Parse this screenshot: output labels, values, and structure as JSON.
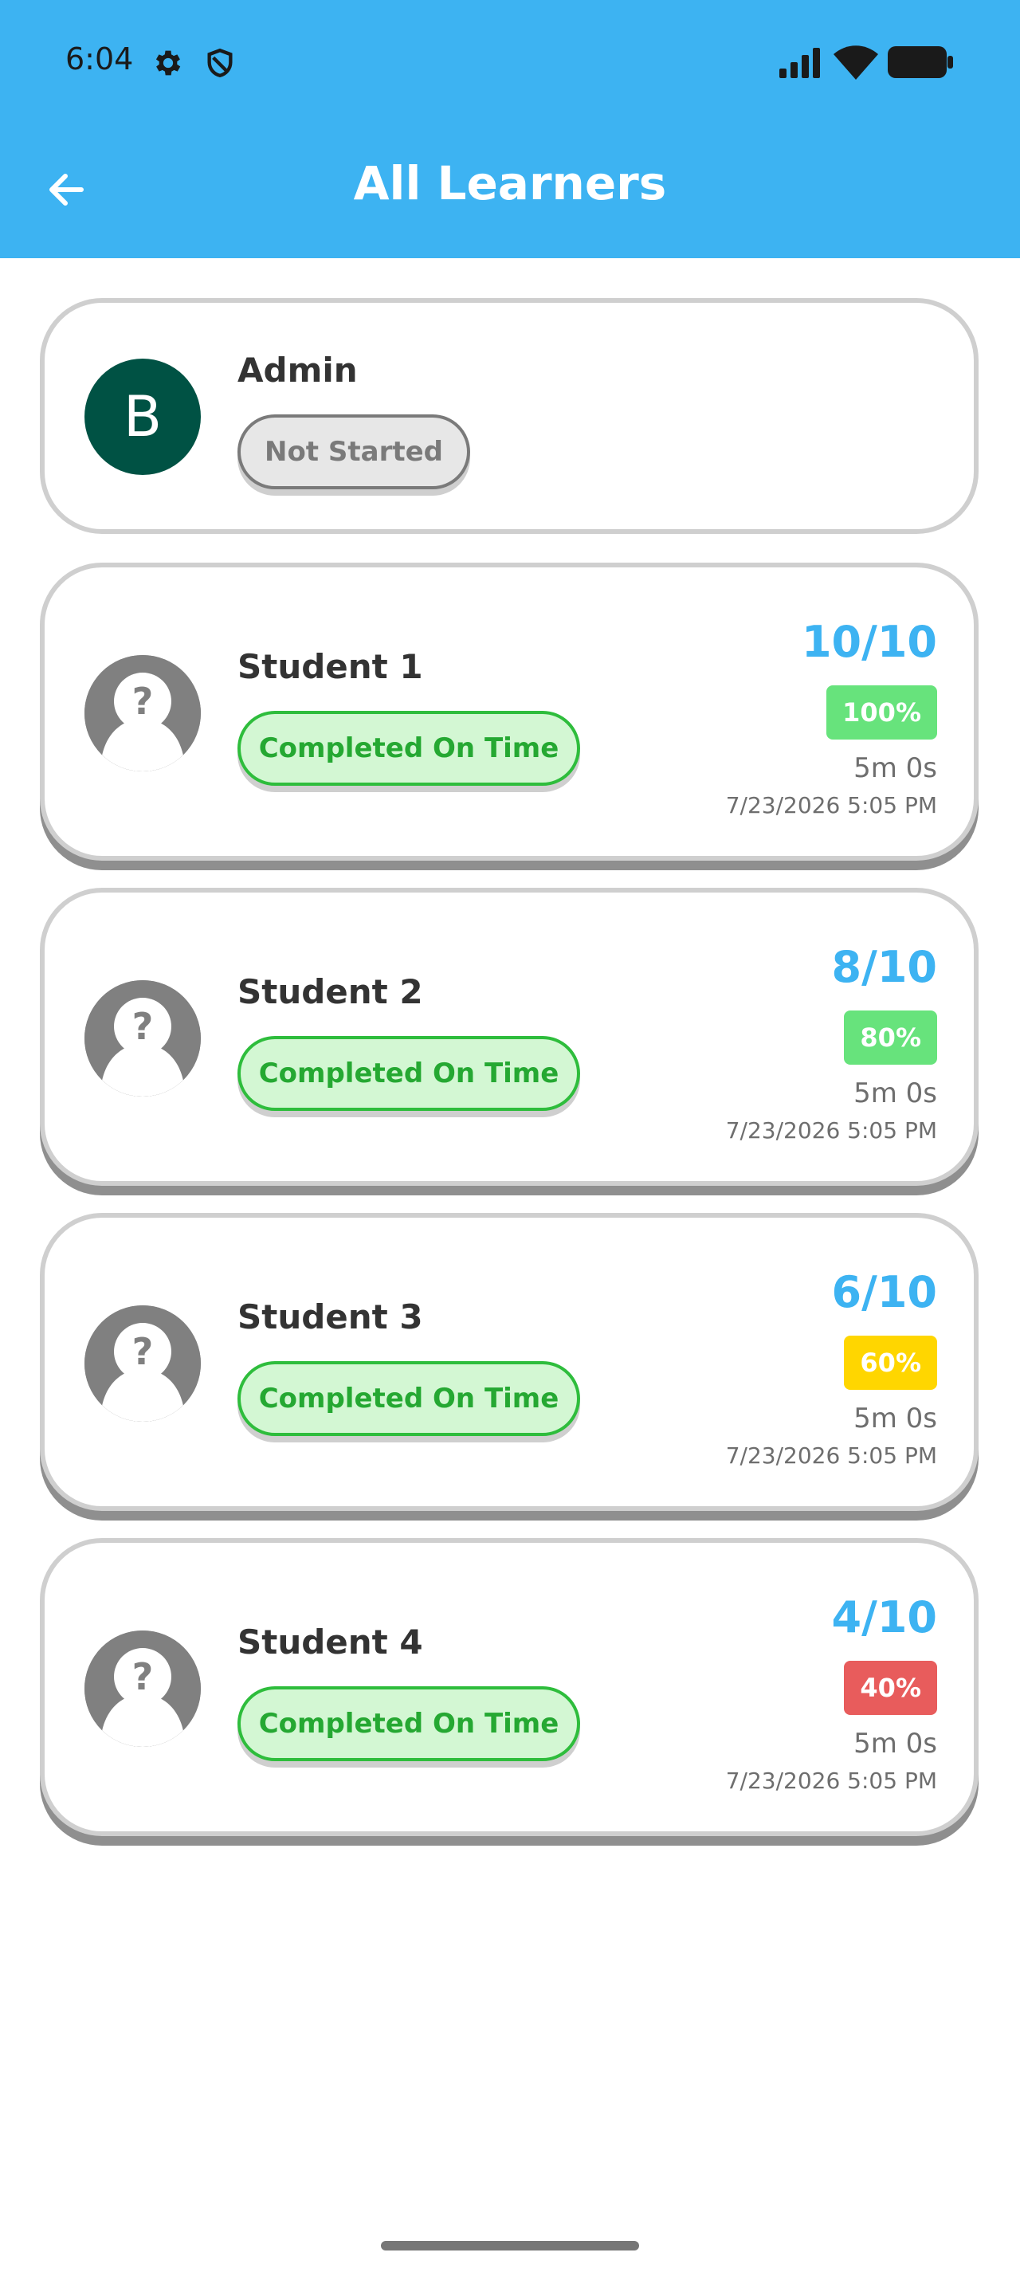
{
  "status_bar": {
    "time": "6:04"
  },
  "header": {
    "title": "All Learners"
  },
  "colors": {
    "accent": "#3db3f2",
    "completed_green": "#2ebd3c",
    "pct_high": "#67e37c",
    "pct_mid": "#ffd600",
    "pct_low": "#e85c5c"
  },
  "admin": {
    "initial": "B",
    "name": "Admin",
    "status": "Not Started"
  },
  "learners": [
    {
      "name": "Student 1",
      "status": "Completed On Time",
      "score": "10/10",
      "percent": "100%",
      "duration": "5m 0s",
      "date": "7/23/2026 5:05 PM"
    },
    {
      "name": "Student 2",
      "status": "Completed On Time",
      "score": "8/10",
      "percent": "80%",
      "duration": "5m 0s",
      "date": "7/23/2026 5:05 PM"
    },
    {
      "name": "Student 3",
      "status": "Completed On Time",
      "score": "6/10",
      "percent": "60%",
      "duration": "5m 0s",
      "date": "7/23/2026 5:05 PM"
    },
    {
      "name": "Student 4",
      "status": "Completed On Time",
      "score": "4/10",
      "percent": "40%",
      "duration": "5m 0s",
      "date": "7/23/2026 5:05 PM"
    }
  ]
}
